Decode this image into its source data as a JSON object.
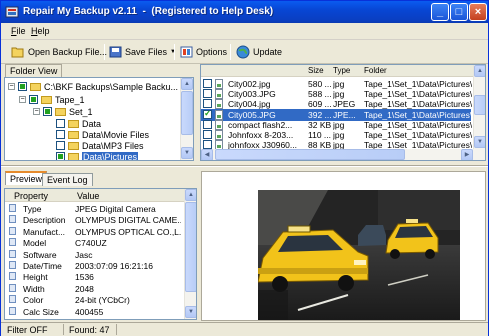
{
  "window": {
    "title": "Repair My Backup v2.11  -  (Registered to Help Desk)"
  },
  "menu": [
    {
      "label": "File",
      "underline": "F",
      "rest": "ile"
    },
    {
      "label": "Help",
      "underline": "H",
      "rest": "elp"
    }
  ],
  "toolbar": {
    "open_label": "Open Backup File...",
    "save_label": "Save Files",
    "options_label": "Options",
    "update_label": "Update"
  },
  "folder_view": {
    "label": "Folder View",
    "tree": [
      {
        "text": "C:\\BKF Backups\\Sample Backu..."
      },
      {
        "text": "Tape_1"
      },
      {
        "text": "Set_1"
      },
      {
        "text": "Data"
      },
      {
        "text": "Data\\Movie Files"
      },
      {
        "text": "Data\\MP3 Files"
      },
      {
        "text": "Data\\Pictures"
      }
    ]
  },
  "file_list": {
    "headers": {
      "name": "",
      "size": "Size",
      "type": "Type",
      "folder": "Folder"
    },
    "rows": [
      {
        "name": "City002.jpg",
        "size": "580 ...",
        "type": "jpg",
        "folder": "Tape_1\\Set_1\\Data\\Pictures\\",
        "checked": false
      },
      {
        "name": "City003.JPG",
        "size": "588 ...",
        "type": "jpg",
        "folder": "Tape_1\\Set_1\\Data\\Pictures\\",
        "checked": false
      },
      {
        "name": "City004.jpg",
        "size": "609 ...",
        "type": "JPEG",
        "folder": "Tape_1\\Set_1\\Data\\Pictures\\",
        "checked": false
      },
      {
        "name": "City005.JPG",
        "size": "392 ...",
        "type": "JPE...",
        "folder": "Tape_1\\Set_1\\Data\\Pictures\\",
        "checked": true
      },
      {
        "name": "compact flash2...",
        "size": "32 KB",
        "type": "jpg",
        "folder": "Tape_1\\Set_1\\Data\\Pictures\\",
        "checked": false
      },
      {
        "name": "Johnfoxx 8-203...",
        "size": "110 ...",
        "type": "jpg",
        "folder": "Tape_1\\Set_1\\Data\\Pictures\\",
        "checked": false
      },
      {
        "name": "johnfoxx J30960...",
        "size": "88 KB",
        "type": "jpg",
        "folder": "Tape_1\\Set_1\\Data\\Pictures\\",
        "checked": false
      }
    ]
  },
  "tabs": [
    "Preview",
    "Event Log"
  ],
  "properties": {
    "headers": {
      "property": "Property",
      "value": "Value"
    },
    "rows": [
      {
        "property": "Type",
        "value": "JPEG Digital Camera"
      },
      {
        "property": "Description",
        "value": "OLYMPUS DIGITAL CAME..."
      },
      {
        "property": "Manufact...",
        "value": "OLYMPUS OPTICAL CO.,L..."
      },
      {
        "property": "Model",
        "value": "C740UZ"
      },
      {
        "property": "Software",
        "value": "Jasc"
      },
      {
        "property": "Date/Time",
        "value": "2003:07:09 16:21:16"
      },
      {
        "property": "Height",
        "value": "1536"
      },
      {
        "property": "Width",
        "value": "2048"
      },
      {
        "property": "Color",
        "value": "24-bit (YCbCr)"
      },
      {
        "property": "Calc Size",
        "value": "400455"
      }
    ]
  },
  "status": {
    "filter": "Filter OFF",
    "found": "Found: 47"
  },
  "colors": {
    "selection": "#316ac5",
    "titlebar": "#0846d4",
    "taxi": "#f2c31a"
  }
}
